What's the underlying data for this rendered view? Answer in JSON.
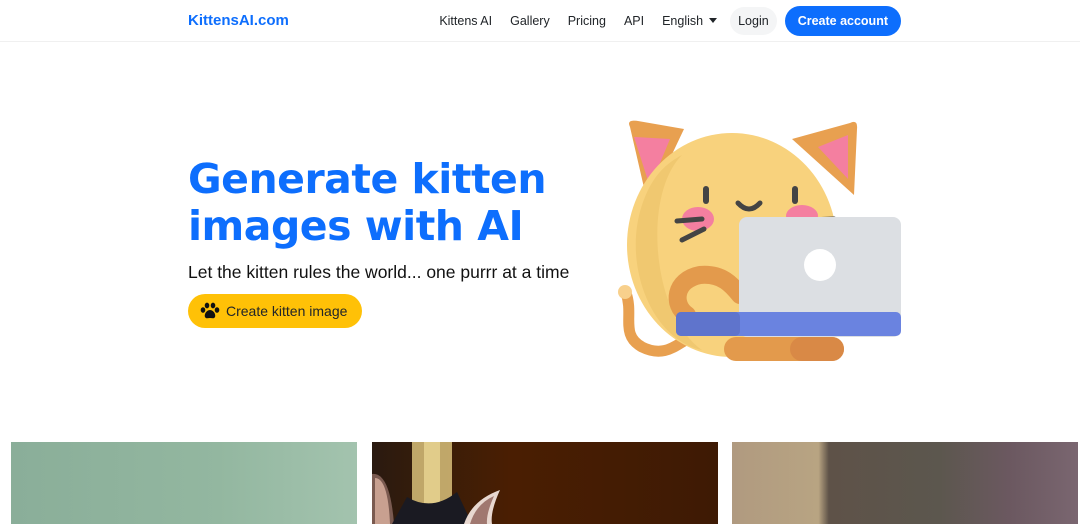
{
  "navbar": {
    "brand": "KittensAI.com",
    "links": [
      "Kittens AI",
      "Gallery",
      "Pricing",
      "API"
    ],
    "language": "English",
    "login_label": "Login",
    "create_account_label": "Create account"
  },
  "hero": {
    "title": "Generate kitten images with AI",
    "subtitle": "Let the kitten rules the world... one purrr at a time",
    "cta_label": "Create kitten image",
    "cta_icon": "paw-icon"
  },
  "colors": {
    "primary": "#0d6efd",
    "cta": "#ffc107"
  },
  "gallery": {
    "items": [
      {
        "alt": "green background kitten image"
      },
      {
        "alt": "kitten ears on dark brown background"
      },
      {
        "alt": "blurred kitten image with beige background"
      }
    ]
  }
}
